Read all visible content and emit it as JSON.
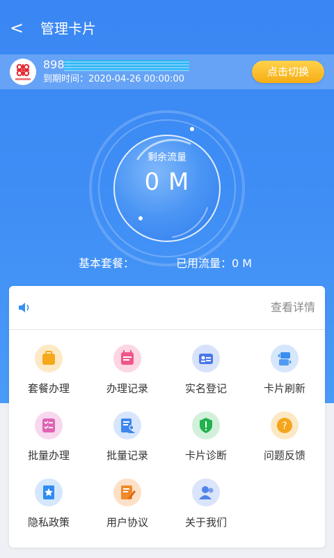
{
  "header": {
    "back_glyph": "<",
    "title": "管理卡片"
  },
  "card": {
    "carrier_logo": "china-unicom-logo",
    "iccid": "8983",
    "expire_text": "到期时间：2020-04-26 00:00:00",
    "switch_label": "点击切换"
  },
  "traffic": {
    "remaining_label": "剩余流量",
    "remaining_value": "0 M"
  },
  "plan": {
    "basic_plan": "基本套餐：",
    "used_traffic": "已用流量：0 M"
  },
  "notice": {
    "icon": "speaker-icon",
    "view_details": "查看详情"
  },
  "services": [
    {
      "label": "套餐办理",
      "icon": "package-icon",
      "color": "#f7a81b"
    },
    {
      "label": "办理记录",
      "icon": "calendar-record-icon",
      "color": "#f0568a"
    },
    {
      "label": "实名登记",
      "icon": "id-card-icon",
      "color": "#4a78e8"
    },
    {
      "label": "卡片刷新",
      "icon": "refresh-card-icon",
      "color": "#3a8ef0"
    },
    {
      "label": "批量办理",
      "icon": "checklist-icon",
      "color": "#e063b3"
    },
    {
      "label": "批量记录",
      "icon": "user-document-icon",
      "color": "#3e86ee"
    },
    {
      "label": "卡片诊断",
      "icon": "shield-alert-icon",
      "color": "#21b24d"
    },
    {
      "label": "问题反馈",
      "icon": "question-icon",
      "color": "#f4a51c"
    },
    {
      "label": "隐私政策",
      "icon": "star-document-icon",
      "color": "#2f8cf0"
    },
    {
      "label": "用户协议",
      "icon": "edit-document-icon",
      "color": "#f08a2a"
    },
    {
      "label": "关于我们",
      "icon": "person-icon",
      "color": "#4f84ea"
    }
  ]
}
